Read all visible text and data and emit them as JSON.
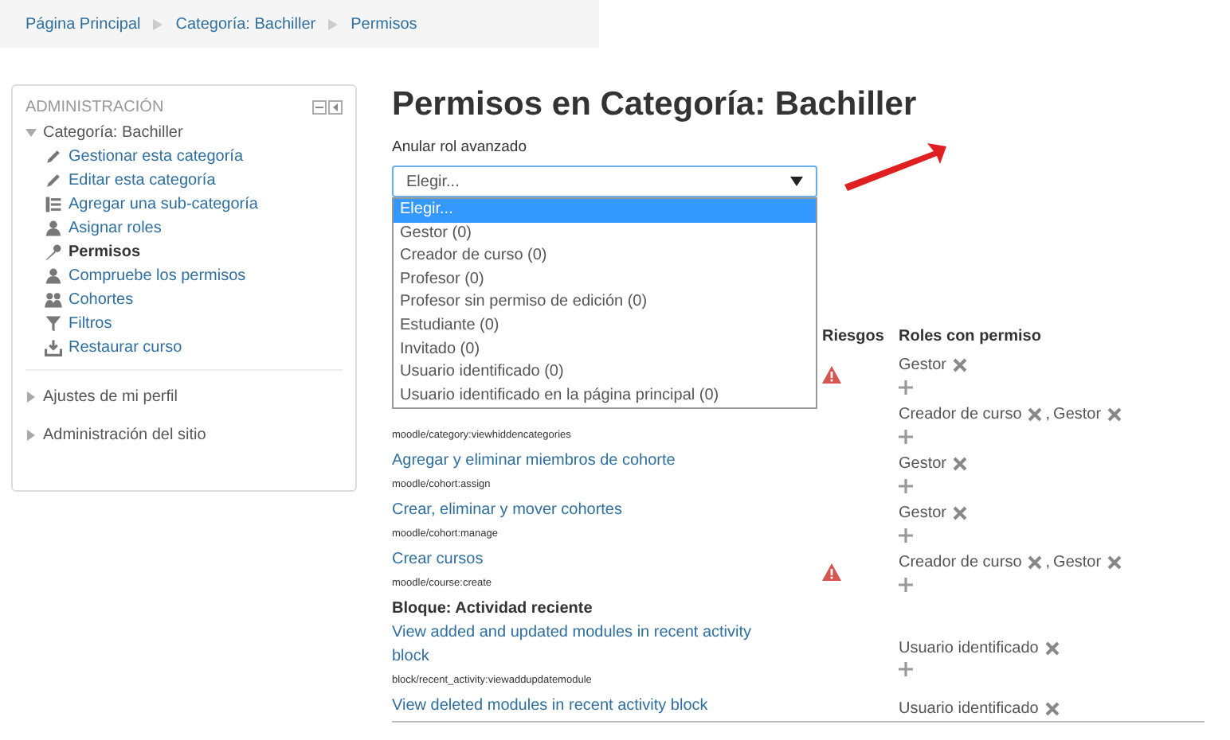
{
  "breadcrumb": [
    {
      "label": "Página Principal"
    },
    {
      "label": "Categoría: Bachiller"
    },
    {
      "label": "Permisos"
    }
  ],
  "admin_block": {
    "title": "ADMINISTRACIÓN",
    "category": {
      "label": "Categoría: Bachiller",
      "expanded": true,
      "children": [
        {
          "label": "Gestionar esta categoría",
          "selected": false
        },
        {
          "label": "Editar esta categoría",
          "selected": false
        },
        {
          "label": "Agregar una sub-categoría",
          "selected": false
        },
        {
          "label": "Asignar roles",
          "selected": false
        },
        {
          "label": "Permisos",
          "selected": true
        },
        {
          "label": "Compruebe los permisos",
          "selected": false
        },
        {
          "label": "Cohortes",
          "selected": false
        },
        {
          "label": "Filtros",
          "selected": false
        },
        {
          "label": "Restaurar curso",
          "selected": false
        }
      ]
    },
    "sections": [
      {
        "label": "Ajustes de mi perfil",
        "expanded": false
      },
      {
        "label": "Administración del sitio",
        "expanded": false
      }
    ]
  },
  "page_title": "Permisos en Categoría: Bachiller",
  "override": {
    "label": "Anular rol avanzado",
    "value": "Elegir...",
    "options": [
      {
        "label": "Elegir...",
        "selected": true
      },
      {
        "label": "Gestor (0)",
        "selected": false
      },
      {
        "label": "Creador de curso (0)",
        "selected": false
      },
      {
        "label": "Profesor (0)",
        "selected": false
      },
      {
        "label": "Profesor sin permiso de edición (0)",
        "selected": false
      },
      {
        "label": "Estudiante (0)",
        "selected": false
      },
      {
        "label": "Invitado (0)",
        "selected": false
      },
      {
        "label": "Usuario identificado (0)",
        "selected": false
      },
      {
        "label": "Usuario identificado en la página principal (0)",
        "selected": false
      }
    ]
  },
  "table": {
    "columns": [
      "Riesgos",
      "Roles con permiso"
    ],
    "role_separator": ",",
    "rows": [
      {
        "kind": "capability",
        "risk": true,
        "roles": [
          "Gestor"
        ]
      },
      {
        "kind": "capability",
        "code": "moodle/category:viewhiddencategories",
        "risk": false,
        "roles": [
          "Creador de curso",
          "Gestor"
        ]
      },
      {
        "kind": "capability",
        "name": "Agregar y eliminar miembros de cohorte",
        "code": "moodle/cohort:assign",
        "risk": false,
        "roles": [
          "Gestor"
        ]
      },
      {
        "kind": "capability",
        "name": "Crear, eliminar y mover cohortes",
        "code": "moodle/cohort:manage",
        "risk": false,
        "roles": [
          "Gestor"
        ]
      },
      {
        "kind": "capability",
        "name": "Crear cursos",
        "code": "moodle/course:create",
        "risk": true,
        "roles": [
          "Creador de curso",
          "Gestor"
        ]
      },
      {
        "kind": "group",
        "name": "Bloque: Actividad reciente"
      },
      {
        "kind": "capability",
        "name": "View added and updated modules in recent activity block",
        "code": "block/recent_activity:viewaddupdatemodule",
        "risk": false,
        "roles": [
          "Usuario identificado"
        ]
      },
      {
        "kind": "capability",
        "name": "View deleted modules in recent activity block",
        "risk": false,
        "roles": [
          "Usuario identificado"
        ]
      }
    ]
  }
}
